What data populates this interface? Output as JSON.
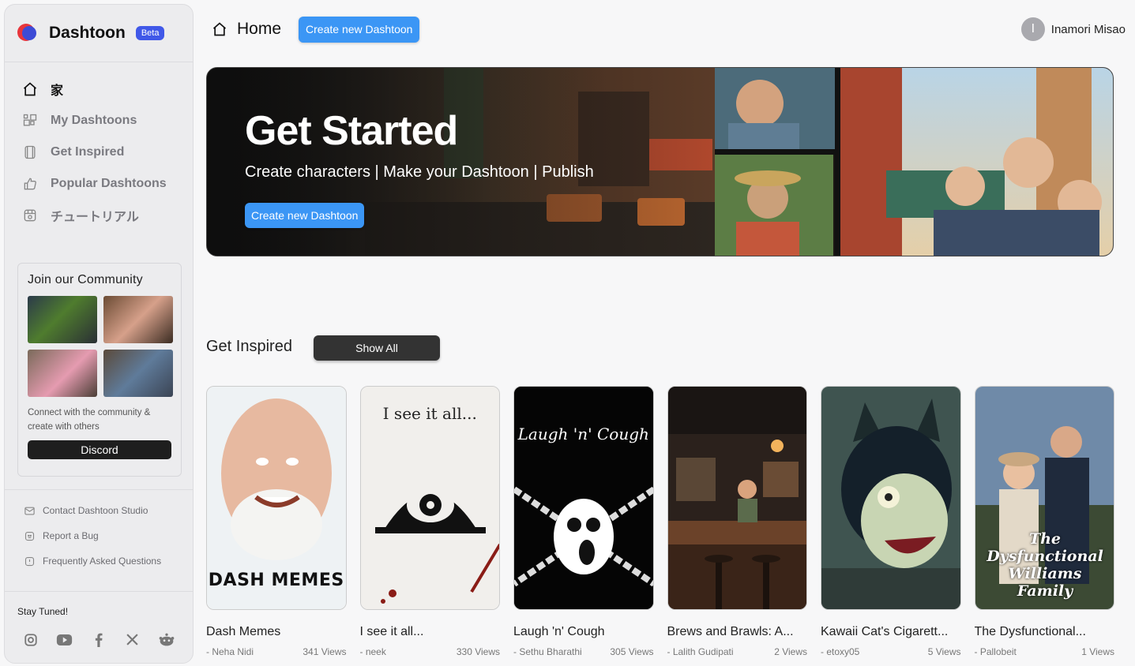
{
  "sidebar": {
    "brand": "Dashtoon",
    "beta": "Beta",
    "nav": [
      {
        "label": "家",
        "icon": "home-icon",
        "active": true
      },
      {
        "label": "My Dashtoons",
        "icon": "grid-icon"
      },
      {
        "label": "Get Inspired",
        "icon": "layers-icon"
      },
      {
        "label": "Popular Dashtoons",
        "icon": "thumbs-up-icon"
      },
      {
        "label": "チュートリアル",
        "icon": "tutorial-icon"
      }
    ],
    "community": {
      "title": "Join our Community",
      "text": "Connect with the community & create with others",
      "button": "Discord"
    },
    "links": [
      "Contact Dashtoon Studio",
      "Report a Bug",
      "Frequently Asked Questions"
    ],
    "stay_tuned": "Stay Tuned!",
    "socials": [
      "instagram-icon",
      "youtube-icon",
      "facebook-icon",
      "x-icon",
      "reddit-icon"
    ]
  },
  "header": {
    "title": "Home",
    "create_button": "Create new Dashtoon",
    "user_initial": "I",
    "user_name": "Inamori Misao"
  },
  "hero": {
    "title": "Get Started",
    "subtitle": "Create characters | Make your Dashtoon | Publish",
    "button": "Create new Dashtoon"
  },
  "inspired": {
    "title": "Get Inspired",
    "show_all": "Show All",
    "cards": [
      {
        "title": "Dash Memes",
        "author": "- Neha Nidi",
        "views": "341 Views",
        "cover_text": "DASH MEMES"
      },
      {
        "title": "I see it all...",
        "author": "- neek",
        "views": "330 Views",
        "cover_text": "I see it all..."
      },
      {
        "title": "Laugh 'n' Cough",
        "author": "- Sethu Bharathi",
        "views": "305 Views",
        "cover_text": "Laugh 'n' Cough"
      },
      {
        "title": "Brews and Brawls: A...",
        "author": "- Lalith Gudipati",
        "views": "2 Views",
        "cover_text": ""
      },
      {
        "title": "Kawaii Cat's Cigarett...",
        "author": "- etoxy05",
        "views": "5 Views",
        "cover_text": ""
      },
      {
        "title": "The Dysfunctional...",
        "author": "- Pallobeit",
        "views": "1 Views",
        "cover_text": "The Dysfunctional Williams Family"
      }
    ]
  }
}
